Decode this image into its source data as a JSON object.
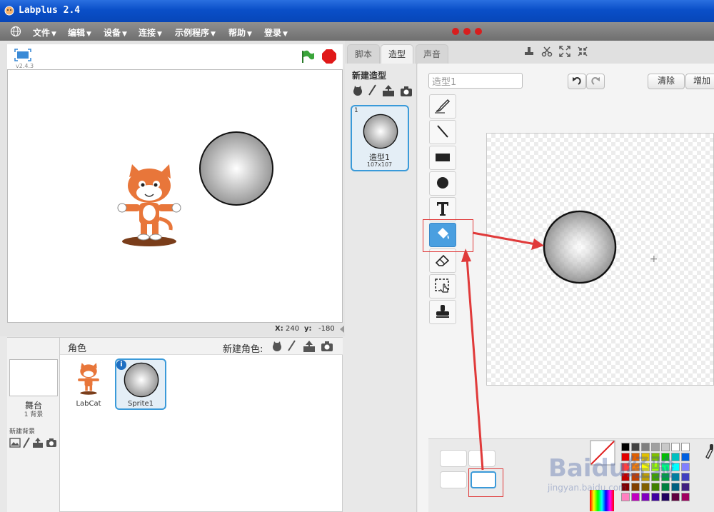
{
  "window": {
    "title": "Labplus 2.4"
  },
  "menu": {
    "items": [
      "文件",
      "编辑",
      "设备",
      "连接",
      "示例程序",
      "帮助",
      "登录"
    ]
  },
  "stage": {
    "version": "v2.4.3",
    "coords": {
      "x_label": "X:",
      "x_value": "240",
      "y_label": "y:",
      "y_value": "-180"
    }
  },
  "sprites": {
    "header_label": "角色",
    "new_sprite_label": "新建角色:",
    "stage_label": "舞台",
    "stage_sub": "1 背景",
    "new_backdrop_label": "新建背景",
    "list": [
      {
        "name": "LabCat"
      },
      {
        "name": "Sprite1",
        "selected": true
      }
    ]
  },
  "editor": {
    "tabs": [
      "脚本",
      "造型",
      "声音"
    ],
    "active_tab": "造型",
    "new_costume_label": "新建造型",
    "costume": {
      "index": "1",
      "name": "造型1",
      "size": "107x107"
    },
    "costume_name_value": "造型1",
    "clear_label": "清除",
    "add_label": "增加",
    "tools": [
      "brush",
      "line",
      "rectangle",
      "ellipse",
      "text",
      "fill",
      "eraser",
      "select",
      "stamp"
    ],
    "selected_tool": "fill"
  },
  "watermark": {
    "main": "Baidu经验",
    "sub": "jingyan.baidu.com"
  },
  "colors": {
    "titlebar": "#0a4fc8",
    "selection": "#3a9ad9",
    "annotation_red": "#e03a3a",
    "fill_tool": "#4a9fe0"
  }
}
